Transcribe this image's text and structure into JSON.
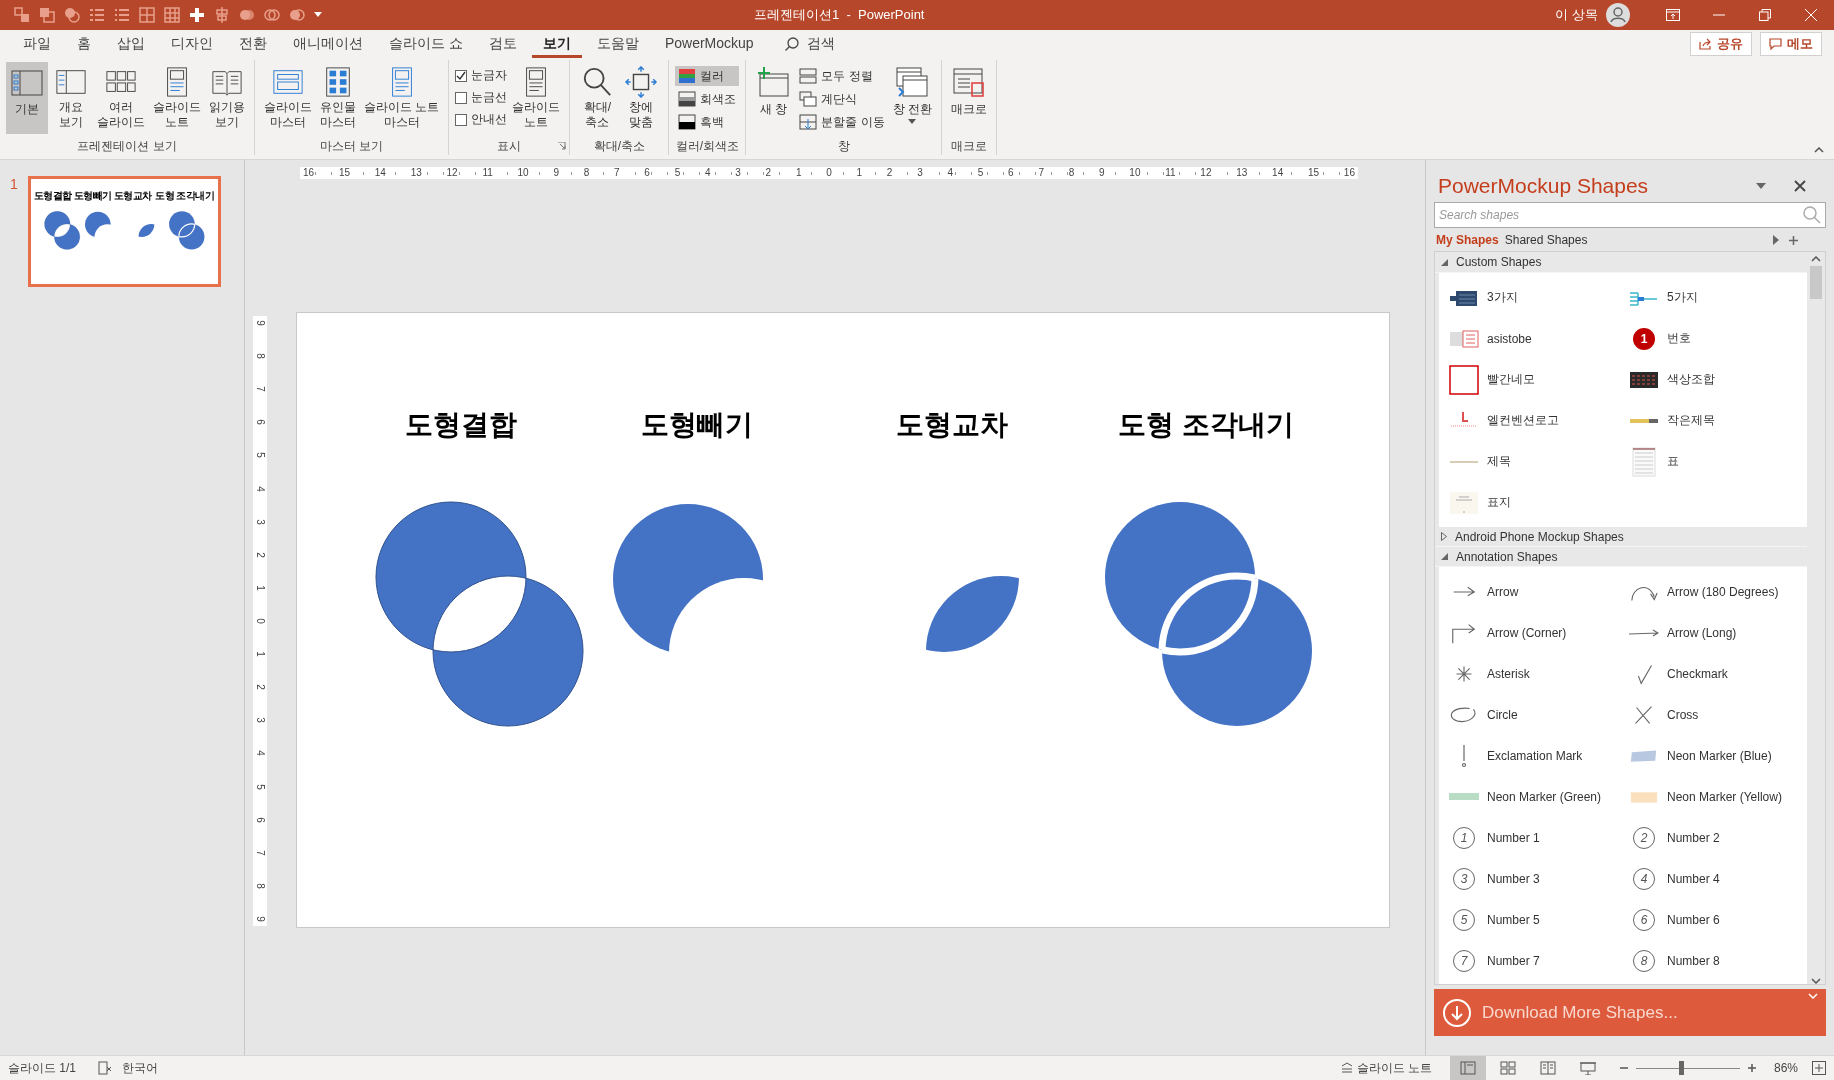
{
  "title_bar": {
    "title": "프레젠테이션1  -  PowerPoint",
    "user": "이 상목"
  },
  "menu_tabs": [
    {
      "label": "파일",
      "selected": false
    },
    {
      "label": "홈",
      "selected": false
    },
    {
      "label": "삽입",
      "selected": false
    },
    {
      "label": "디자인",
      "selected": false
    },
    {
      "label": "전환",
      "selected": false
    },
    {
      "label": "애니메이션",
      "selected": false
    },
    {
      "label": "슬라이드 쇼",
      "selected": false
    },
    {
      "label": "검토",
      "selected": false
    },
    {
      "label": "보기",
      "selected": true
    },
    {
      "label": "도움말",
      "selected": false
    },
    {
      "label": "PowerMockup",
      "selected": false
    }
  ],
  "search_label": "검색",
  "share_button": "공유",
  "comment_button": "메모",
  "ribbon": [
    {
      "label": "프레젠테이션 보기",
      "launcher": false,
      "items": [
        {
          "kind": "large",
          "label": "기본",
          "selected": true,
          "dropdown": false
        },
        {
          "kind": "large",
          "label": "개요\n보기",
          "selected": false,
          "dropdown": false
        },
        {
          "kind": "large",
          "label": "여러\n슬라이드",
          "selected": false,
          "dropdown": false
        },
        {
          "kind": "large",
          "label": "슬라이드\n노트",
          "selected": false,
          "dropdown": false
        },
        {
          "kind": "large",
          "label": "읽기용\n보기",
          "selected": false,
          "dropdown": false
        }
      ]
    },
    {
      "label": "마스터 보기",
      "launcher": false,
      "items": [
        {
          "kind": "large",
          "label": "슬라이드\n마스터",
          "selected": false,
          "dropdown": false
        },
        {
          "kind": "large",
          "label": "유인물\n마스터",
          "selected": false,
          "dropdown": false
        },
        {
          "kind": "large",
          "label": "슬라이드 노트\n마스터",
          "selected": false,
          "dropdown": false
        }
      ]
    },
    {
      "label": "표시",
      "launcher": true,
      "items": [
        {
          "kind": "check",
          "label": "눈금자",
          "checked": true
        },
        {
          "kind": "check",
          "label": "눈금선",
          "checked": false
        },
        {
          "kind": "check",
          "label": "안내선",
          "checked": false
        },
        {
          "kind": "large",
          "label": "슬라이드\n노트",
          "selected": false,
          "dropdown": false
        }
      ]
    },
    {
      "label": "확대/축소",
      "launcher": false,
      "items": [
        {
          "kind": "large",
          "label": "확대/\n축소",
          "selected": false,
          "dropdown": false
        },
        {
          "kind": "large",
          "label": "창에\n맞춤",
          "selected": false,
          "dropdown": false
        }
      ]
    },
    {
      "label": "컬러/회색조",
      "launcher": false,
      "items": [
        {
          "kind": "small",
          "label": "컬러",
          "selected": true
        },
        {
          "kind": "small",
          "label": "회색조",
          "selected": false
        },
        {
          "kind": "small",
          "label": "흑백",
          "selected": false
        }
      ]
    },
    {
      "label": "창",
      "launcher": false,
      "items": [
        {
          "kind": "large",
          "label": "새 창",
          "selected": false,
          "dropdown": false
        },
        {
          "kind": "small",
          "label": "모두 정렬",
          "selected": false
        },
        {
          "kind": "small",
          "label": "계단식",
          "selected": false
        },
        {
          "kind": "small",
          "label": "분할줄 이동",
          "selected": false
        },
        {
          "kind": "large",
          "label": "창 전환",
          "selected": false,
          "dropdown": true
        }
      ]
    },
    {
      "label": "매크로",
      "launcher": false,
      "items": [
        {
          "kind": "large",
          "label": "매크로",
          "selected": false,
          "dropdown": false
        }
      ]
    }
  ],
  "thumbnail": {
    "number": "1",
    "selected": true,
    "titles": [
      "도형결합",
      "도형빼기",
      "도형교차",
      "도형 조각내기"
    ]
  },
  "ruler": {
    "horizontal": [
      "16",
      "15",
      "14",
      "13",
      "12",
      "11",
      "10",
      "9",
      "8",
      "7",
      "6",
      "5",
      "4",
      "3",
      "2",
      "1",
      "0",
      "1",
      "2",
      "3",
      "4",
      "5",
      "6",
      "7",
      "8",
      "9",
      "10",
      "11",
      "12",
      "13",
      "14",
      "15",
      "16"
    ],
    "vertical": [
      "9",
      "8",
      "7",
      "6",
      "5",
      "4",
      "3",
      "2",
      "1",
      "0",
      "1",
      "2",
      "3",
      "4",
      "5",
      "6",
      "7",
      "8",
      "9"
    ]
  },
  "slide": {
    "titles": [
      "도형결합",
      "도형빼기",
      "도형교차",
      "도형 조각내기"
    ]
  },
  "panel": {
    "title": "PowerMockup Shapes",
    "search_placeholder": "Search shapes",
    "tabs": [
      {
        "label": "My Shapes",
        "selected": true
      },
      {
        "label": "Shared Shapes",
        "selected": false
      }
    ],
    "sections": [
      {
        "label": "Custom Shapes",
        "expanded": true,
        "items": [
          {
            "label": "3가지"
          },
          {
            "label": "5가지"
          },
          {
            "label": "asistobe"
          },
          {
            "label": "번호",
            "badge": "1"
          },
          {
            "label": "빨간네모"
          },
          {
            "label": "색상조합"
          },
          {
            "label": "엘컨벤션로고"
          },
          {
            "label": "작은제목"
          },
          {
            "label": "제목"
          },
          {
            "label": "표"
          },
          {
            "label": "표지"
          }
        ]
      },
      {
        "label": "Android Phone Mockup Shapes",
        "expanded": false
      },
      {
        "label": "Annotation Shapes",
        "expanded": true,
        "items": [
          {
            "label": "Arrow"
          },
          {
            "label": "Arrow (180 Degrees)"
          },
          {
            "label": "Arrow (Corner)"
          },
          {
            "label": "Arrow (Long)"
          },
          {
            "label": "Asterisk"
          },
          {
            "label": "Checkmark"
          },
          {
            "label": "Circle"
          },
          {
            "label": "Cross"
          },
          {
            "label": "Exclamation Mark"
          },
          {
            "label": "Neon Marker (Blue)"
          },
          {
            "label": "Neon Marker (Green)"
          },
          {
            "label": "Neon Marker (Yellow)"
          },
          {
            "label": "Number 1",
            "badge": "1"
          },
          {
            "label": "Number 2",
            "badge": "2"
          },
          {
            "label": "Number 3",
            "badge": "3"
          },
          {
            "label": "Number 4",
            "badge": "4"
          },
          {
            "label": "Number 5",
            "badge": "5"
          },
          {
            "label": "Number 6",
            "badge": "6"
          },
          {
            "label": "Number 7",
            "badge": "7"
          },
          {
            "label": "Number 8",
            "badge": "8"
          }
        ]
      }
    ],
    "download": "Download More Shapes..."
  },
  "status_bar": {
    "slide_info": "슬라이드 1/1",
    "language": "한국어",
    "notes": "슬라이드 노트",
    "views": [
      {
        "selected": true
      },
      {
        "selected": false
      },
      {
        "selected": false
      },
      {
        "selected": false
      }
    ],
    "zoom": {
      "level": 0.43,
      "label": "86%"
    }
  }
}
